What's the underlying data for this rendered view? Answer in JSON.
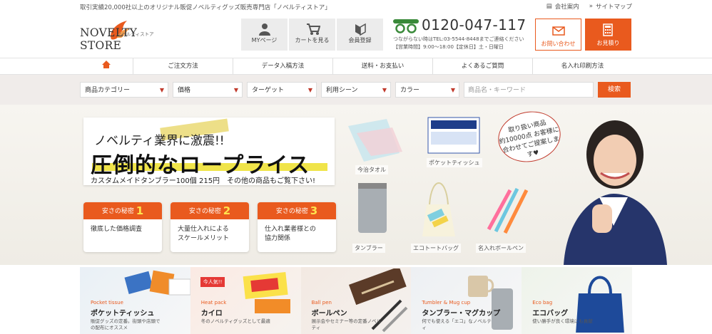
{
  "topbar": {
    "tagline": "取引実績20,000社以上のオリジナル販促ノベルティグッズ販売専門店「ノベルティストア」",
    "company_link": "会社案内",
    "sitemap_link": "サイトマップ"
  },
  "logo": {
    "name": "NOVELTY STORE",
    "kana": "ノベルティストア"
  },
  "header": {
    "mypage": "MYページ",
    "cart": "カートを見る",
    "register": "会員登録",
    "phone": "0120-047-117",
    "phone_sub": "つながらない時はTEL:03-5544-8448までご連絡ください",
    "hours": "【営業時間】9:00〜18:00【定休日】土・日曜日",
    "contact": "お問い合わせ",
    "estimate": "お見積り"
  },
  "nav": {
    "items": [
      "ご注文方法",
      "データ入稿方法",
      "送料・お支払い",
      "よくあるご質問",
      "名入れ印刷方法"
    ]
  },
  "search": {
    "category": "商品カテゴリー",
    "price": "価格",
    "target": "ターゲット",
    "scene": "利用シーン",
    "color": "カラー",
    "keyword_placeholder": "商品名・キーワード",
    "button": "検索"
  },
  "hero": {
    "headline1": "ノベルティ業界に激震!!",
    "headline2": "圧倒的なロープライス",
    "headline3": "カスタムメイドタンブラー100個 215円　その他の商品もご覧下さい!",
    "secrets": [
      {
        "label": "安さの秘密",
        "num": "1",
        "text": "徹底した価格調査"
      },
      {
        "label": "安さの秘密",
        "num": "2",
        "text": "大量仕入れによる\nスケールメリット"
      },
      {
        "label": "安さの秘密",
        "num": "3",
        "text": "仕入れ業者様との\n協力関係"
      }
    ],
    "products": [
      "今治タオル",
      "ポケットティッシュ",
      "タンブラー",
      "エコトートバッグ",
      "名入れボールペン"
    ],
    "bubble": "取り扱い商品\n約10000点 お客様に\n合わせてご提案します♥"
  },
  "categories": [
    {
      "en": "Pocket tissue",
      "jp": "ポケットティッシュ",
      "desc": "販促グッズの定番。街頭や店頭での配布にオススメ",
      "badge": ""
    },
    {
      "en": "Heat pack",
      "jp": "カイロ",
      "desc": "冬のノベルティグッズとして最適",
      "badge": "今人気!!"
    },
    {
      "en": "Ball pen",
      "jp": "ボールペン",
      "desc": "展示会やセミナー等の定番ノベルティ",
      "badge": ""
    },
    {
      "en": "Tumbler & Mug cup",
      "jp": "タンブラー・マグカップ",
      "desc": "何でも使える「エコ」なノベルティ",
      "badge": ""
    },
    {
      "en": "Eco bag",
      "jp": "エコバッグ",
      "desc": "使い勝手が良く環境にも貢献",
      "badge": ""
    }
  ],
  "colors": {
    "accent": "#e95a1e",
    "nav_bg": "#f0ecea",
    "phone_green": "#3a8a3a"
  }
}
